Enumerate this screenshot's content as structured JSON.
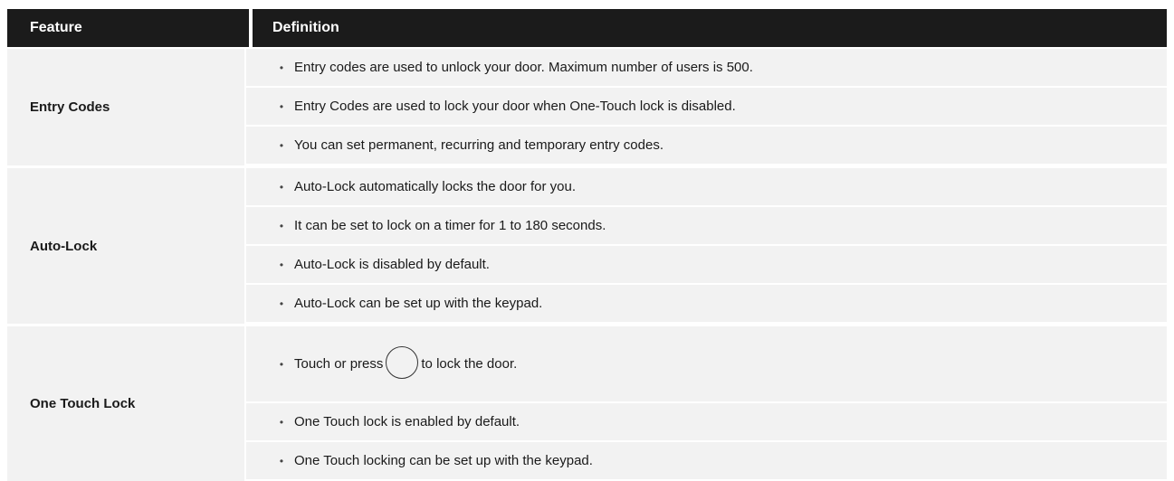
{
  "header": {
    "feature": "Feature",
    "definition": "Definition"
  },
  "groups": [
    {
      "feature": "Entry Codes",
      "items": [
        "Entry codes are used to unlock your door. Maximum number of users is 500.",
        "Entry Codes are used to lock your door when One-Touch lock is disabled.",
        "You can set permanent, recurring and temporary entry codes."
      ]
    },
    {
      "feature": "Auto-Lock",
      "items": [
        "Auto-Lock automatically locks the door for you.",
        "It can be set to lock on a timer for 1 to 180 seconds.",
        "Auto-Lock is disabled by default.",
        "Auto-Lock can be set up with the keypad."
      ]
    },
    {
      "feature": "One Touch Lock",
      "items": [
        {
          "before": "Touch or press",
          "icon": "lock-button-circle-icon",
          "after": "to lock the door."
        },
        "One Touch lock is enabled by default.",
        "One Touch locking can be set up with the keypad."
      ]
    }
  ],
  "bullet": "•"
}
